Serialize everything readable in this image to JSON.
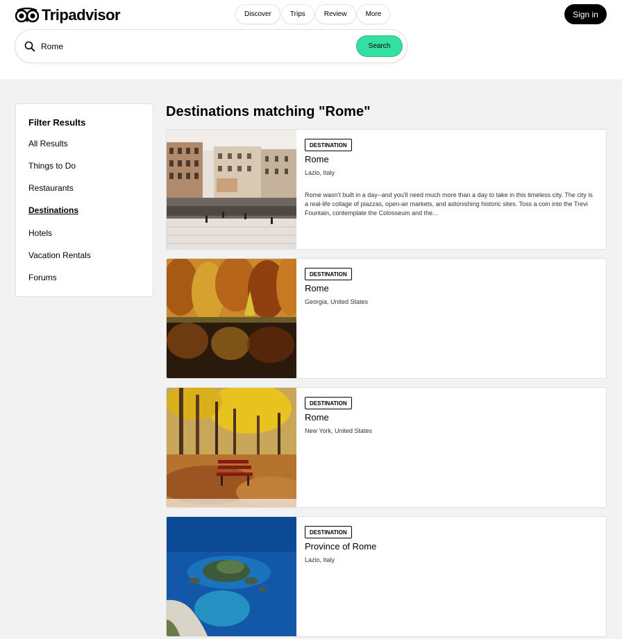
{
  "brand": {
    "name": "Tripadvisor"
  },
  "nav": {
    "items": [
      "Discover",
      "Trips",
      "Review",
      "More"
    ]
  },
  "account": {
    "signin_label": "Sign in"
  },
  "search": {
    "value": "Rome",
    "button_label": "Search"
  },
  "filters": {
    "title": "Filter Results",
    "items": [
      "All Results",
      "Things to Do",
      "Restaurants",
      "Destinations",
      "Hotels",
      "Vacation Rentals",
      "Forums"
    ],
    "active": "Destinations"
  },
  "results": {
    "heading": "Destinations matching \"Rome\"",
    "cards": [
      {
        "badge": "DESTINATION",
        "name": "Rome",
        "location": "Lazio, Italy",
        "description": "Rome wasn't built in a day--and you'll need much more than a day to take in this timeless city. The city is a real-life collage of piazzas, open-air markets, and astonishing historic sites. Toss a coin into the Trevi Fountain, contemplate the Colosseum and the...",
        "image": "spanish-steps-photo"
      },
      {
        "badge": "DESTINATION",
        "name": "Rome",
        "location": "Georgia, United States",
        "description": "",
        "image": "autumn-lake-photo"
      },
      {
        "badge": "DESTINATION",
        "name": "Rome",
        "location": "New York, United States",
        "description": "",
        "image": "autumn-bench-photo"
      },
      {
        "badge": "DESTINATION",
        "name": "Province of Rome",
        "location": "Lazio, Italy",
        "description": "",
        "image": "island-sea-photo"
      }
    ]
  },
  "colors": {
    "accent": "#34e0a1",
    "dark": "#000000"
  }
}
